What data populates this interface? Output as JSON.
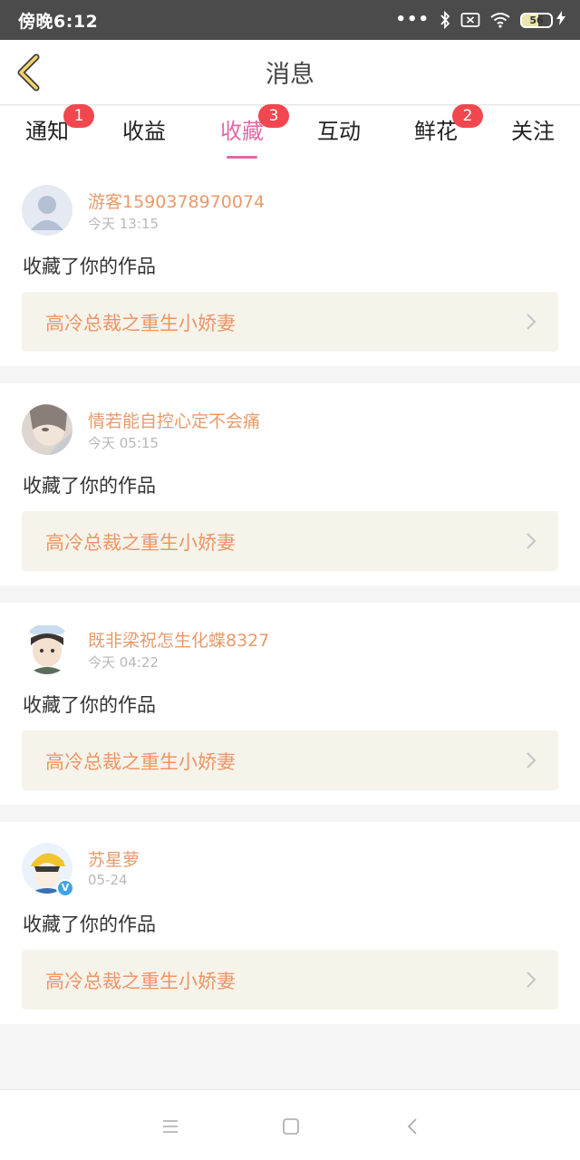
{
  "status_bar": {
    "time": "傍晚6:12",
    "dots": "•••",
    "battery": "56"
  },
  "header": {
    "title": "消息"
  },
  "tabs": [
    {
      "label": "通知",
      "badge": "1",
      "active": false
    },
    {
      "label": "收益",
      "badge": "",
      "active": false
    },
    {
      "label": "收藏",
      "badge": "3",
      "active": true
    },
    {
      "label": "互动",
      "badge": "",
      "active": false
    },
    {
      "label": "鲜花",
      "badge": "2",
      "active": false
    },
    {
      "label": "关注",
      "badge": "",
      "active": false
    }
  ],
  "messages": [
    {
      "user": "游客1590378970074",
      "time": "今天 13:15",
      "text": "收藏了你的作品",
      "work": "高冷总裁之重生小娇妻"
    },
    {
      "user": "情若能自控心定不会痛",
      "time": "今天 05:15",
      "text": "收藏了你的作品",
      "work": "高冷总裁之重生小娇妻"
    },
    {
      "user": "既非梁祝怎生化蝶8327",
      "time": "今天 04:22",
      "text": "收藏了你的作品",
      "work": "高冷总裁之重生小娇妻"
    },
    {
      "user": "苏星萝",
      "time": "05-24",
      "text": "收藏了你的作品",
      "work": "高冷总裁之重生小娇妻"
    }
  ],
  "colors": {
    "accent": "#e06aa4",
    "username": "#e89a6a",
    "work_title": "#ee9566",
    "badge": "#f2474f",
    "status_bar": "#4b4b4b"
  },
  "icons": {
    "back": "chevron-left-icon",
    "bluetooth": "bluetooth-icon",
    "sim": "no-sim-icon",
    "wifi": "wifi-icon",
    "battery": "battery-icon",
    "charging": "charging-icon",
    "nav_menu": "menu-icon",
    "nav_home": "home-icon",
    "nav_back": "back-icon"
  }
}
